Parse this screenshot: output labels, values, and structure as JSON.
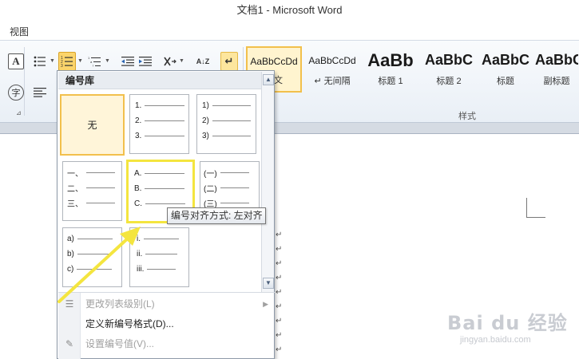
{
  "window": {
    "title": "文档1  -  Microsoft Word"
  },
  "menu": {
    "view": "视图"
  },
  "ribbon": {
    "icons": {
      "font_a": "A",
      "phonetic": "字",
      "bullets": "bullets-icon",
      "numbering": "numbering-icon",
      "multilevel": "multilevel-list-icon",
      "decrease_indent": "decrease-indent-icon",
      "increase_indent": "increase-indent-icon",
      "chinese_layout": "chinese-layout-icon",
      "sort": "sort-icon",
      "show_marks": "show-formatting-marks-icon",
      "align_left": "align-left-icon"
    },
    "sort_label": "A↓Z",
    "show_marks_glyph": "↵",
    "styles_group_label": "样式",
    "styles": [
      {
        "sample": "AaBbCcDd",
        "name": "正文",
        "selected": true
      },
      {
        "sample": "AaBbCcDd",
        "name": "↵ 无间隔",
        "selected": false
      },
      {
        "sample": "AaBb",
        "name": "标题 1",
        "selected": false
      },
      {
        "sample": "AaBbC",
        "name": "标题 2",
        "selected": false
      },
      {
        "sample": "AaBbC",
        "name": "标题",
        "selected": false
      },
      {
        "sample": "AaBbC",
        "name": "副标题",
        "selected": false
      }
    ]
  },
  "numbering_menu": {
    "header": "编号库",
    "none_label": "无",
    "cells": {
      "c1": [
        "1.",
        "2.",
        "3."
      ],
      "c2": [
        "1)",
        "2)",
        "3)"
      ],
      "c3": [
        "一、",
        "二、",
        "三、"
      ],
      "c4": [
        "A.",
        "B.",
        "C."
      ],
      "c5": [
        "(一)",
        "(二)",
        "(三)"
      ],
      "c6": [
        "a)",
        "b)",
        "c)"
      ],
      "c7": [
        "i.",
        "ii.",
        "iii."
      ]
    },
    "menu_items": {
      "change_level": "更改列表级别(L)",
      "define_format": "定义新编号格式(D)...",
      "set_value": "设置编号值(V)..."
    },
    "tooltip": "编号对齐方式: 左对齐"
  },
  "watermark": {
    "main": "Bai du 经验",
    "sub": "jingyan.baidu.com"
  },
  "colors": {
    "highlight": "#f4e53f",
    "selection_gold": "#f2c04c",
    "ribbon_bg": "#e9eff6"
  }
}
